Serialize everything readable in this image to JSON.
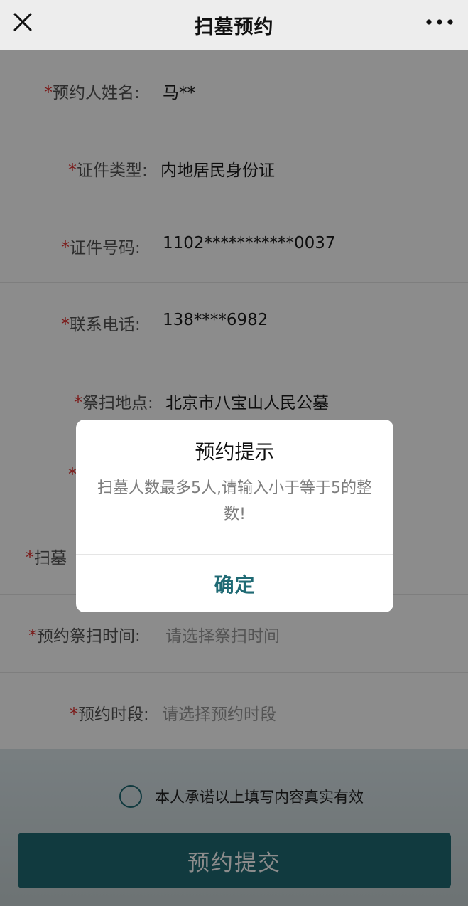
{
  "header": {
    "title": "扫墓预约",
    "close_icon": "close-icon",
    "more_icon": "more-dots-icon"
  },
  "form": {
    "required_mark": "*",
    "rows": [
      {
        "label": "预约人姓名:",
        "value": "马**"
      },
      {
        "label": "证件类型:",
        "value": "内地居民身份证"
      },
      {
        "label": "证件号码:",
        "value": "1102***********0037"
      },
      {
        "label": "联系电话:",
        "value": "138****6982"
      },
      {
        "label": "祭扫地点:",
        "value": "北京市八宝山人民公墓"
      },
      {
        "label": "",
        "value": ""
      },
      {
        "label": "扫墓",
        "value": ""
      },
      {
        "label": "预约祭扫时间:",
        "value": "请选择祭扫时间"
      },
      {
        "label": "预约时段:",
        "value": "请选择预约时段"
      }
    ]
  },
  "agreement": {
    "text": "本人承诺以上填写内容真实有效",
    "checked": false
  },
  "submit_label": "预约提交",
  "dialog": {
    "title": "预约提示",
    "message": "扫墓人数最多5人,请输入小于等于5的整数!",
    "confirm_label": "确定"
  },
  "colors": {
    "accent": "#1f6a74",
    "required": "#e0312f"
  }
}
